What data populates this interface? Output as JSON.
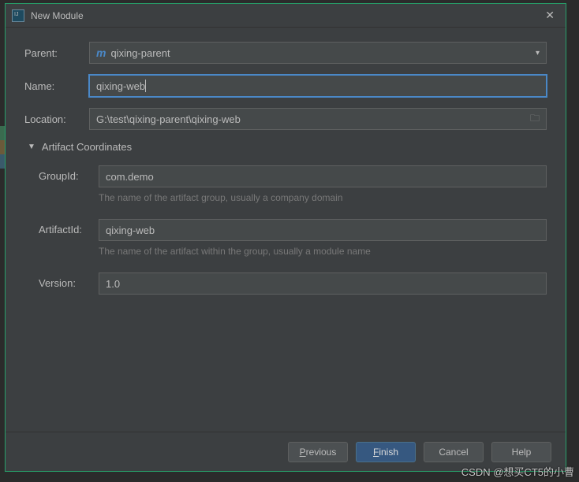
{
  "titlebar": {
    "title": "New Module"
  },
  "form": {
    "parent_label": "Parent:",
    "parent_value": "qixing-parent",
    "name_label": "Name:",
    "name_value": "qixing-web",
    "location_label": "Location:",
    "location_value": "G:\\test\\qixing-parent\\qixing-web"
  },
  "artifact": {
    "section_title": "Artifact Coordinates",
    "groupid_label": "GroupId:",
    "groupid_value": "com.demo",
    "groupid_hint": "The name of the artifact group, usually a company domain",
    "artifactid_label": "ArtifactId:",
    "artifactid_value": "qixing-web",
    "artifactid_hint": "The name of the artifact within the group, usually a module name",
    "version_label": "Version:",
    "version_value": "1.0"
  },
  "buttons": {
    "previous": "Previous",
    "finish": "Finish",
    "cancel": "Cancel",
    "help": "Help"
  },
  "watermark": "CSDN @想买CT5的小曹"
}
